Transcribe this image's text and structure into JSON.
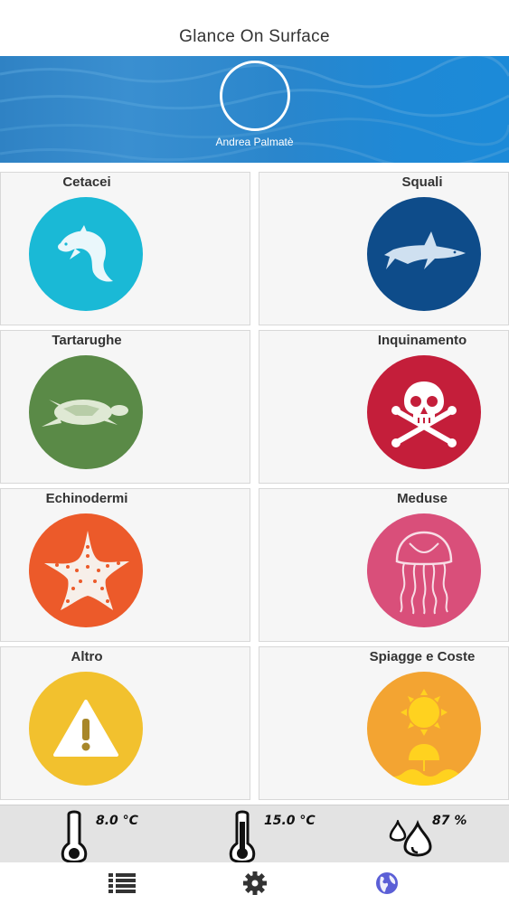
{
  "header": {
    "title": "Glance On Surface"
  },
  "profile": {
    "name": "Andrea Palmatè"
  },
  "categories": [
    {
      "label": "Cetacei",
      "icon": "dolphin-icon",
      "color": "#1ab9d6"
    },
    {
      "label": "Squali",
      "icon": "shark-icon",
      "color": "#0e4c8a"
    },
    {
      "label": "Tartarughe",
      "icon": "turtle-icon",
      "color": "#5a8a47"
    },
    {
      "label": "Inquinamento",
      "icon": "skull-crossbones-icon",
      "color": "#c41e3a"
    },
    {
      "label": "Echinodermi",
      "icon": "starfish-icon",
      "color": "#ec5a2a"
    },
    {
      "label": "Meduse",
      "icon": "jellyfish-icon",
      "color": "#d94f7a"
    },
    {
      "label": "Altro",
      "icon": "warning-icon",
      "color": "#f2c12e"
    },
    {
      "label": "Spiagge e Coste",
      "icon": "beach-sun-icon",
      "color": "#f3a432"
    }
  ],
  "weather": {
    "air_temp": "8.0 °C",
    "water_temp": "15.0 °C",
    "humidity": "87 %"
  },
  "tabs": [
    {
      "icon": "list-icon",
      "active": false
    },
    {
      "icon": "gear-icon",
      "active": false
    },
    {
      "icon": "globe-icon",
      "active": true
    }
  ],
  "colors": {
    "active_tab": "#5b5fd6",
    "inactive_tab": "#333333"
  }
}
